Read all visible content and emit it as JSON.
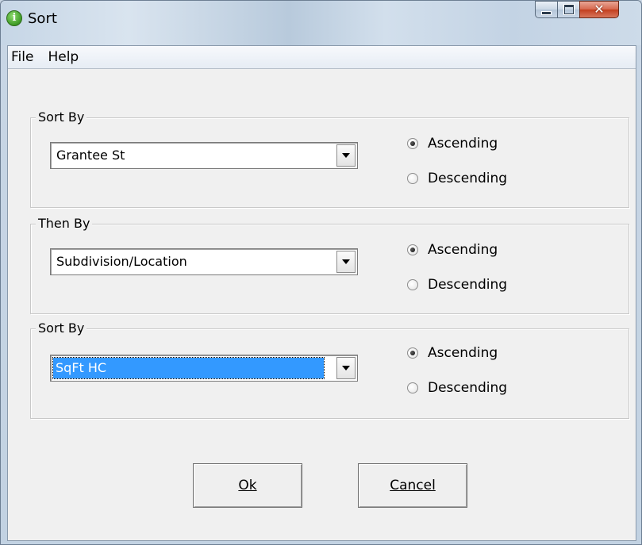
{
  "window": {
    "title": "Sort",
    "icon": "info-icon"
  },
  "menu": [
    {
      "label": "File"
    },
    {
      "label": "Help"
    }
  ],
  "groups": [
    {
      "label": "Sort By",
      "field": "Grantee St",
      "selected": false,
      "order": "Ascending",
      "options": [
        "Ascending",
        "Descending"
      ]
    },
    {
      "label": "Then By",
      "field": "Subdivision/Location",
      "selected": false,
      "order": "Ascending",
      "options": [
        "Ascending",
        "Descending"
      ]
    },
    {
      "label": "Sort By",
      "field": "SqFt HC",
      "selected": true,
      "order": "Ascending",
      "options": [
        "Ascending",
        "Descending"
      ]
    }
  ],
  "buttons": {
    "ok": "Ok",
    "cancel": "Cancel"
  },
  "colors": {
    "selection": "#3399ff",
    "close_button": "#c23e1e"
  }
}
